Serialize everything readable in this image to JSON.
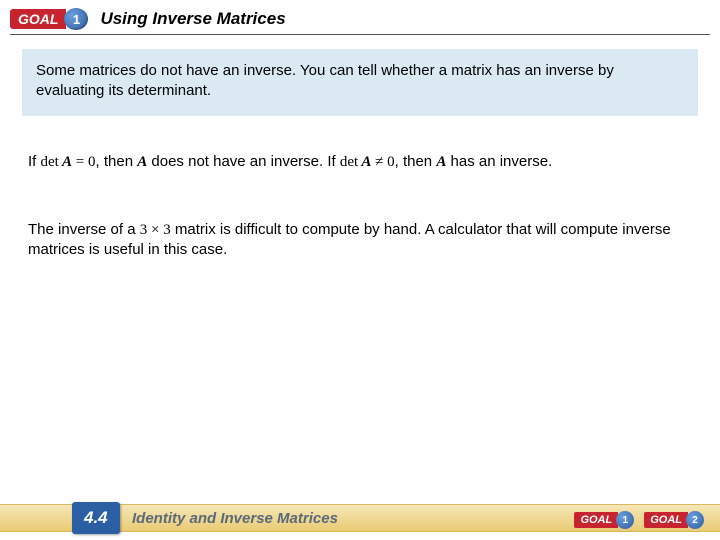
{
  "header": {
    "goal_label": "GOAL",
    "goal_number": "1",
    "title": "Using Inverse Matrices"
  },
  "box": {
    "text": "Some matrices do not have an inverse. You can tell whether a matrix has an inverse by evaluating its determinant."
  },
  "para1": {
    "p1a": "If ",
    "det1": "det",
    "A1": " A",
    "eq_zero": " = 0",
    "p1b": ", then ",
    "A2": "A",
    "p1c": " does not have an inverse. If ",
    "det2": "det",
    "A3": " A",
    "neq": " ≠ 0",
    "p1d": ", then ",
    "A4": "A",
    "p1e": " has an inverse."
  },
  "para2": {
    "p2a": "The inverse of a ",
    "dim": "3 × 3",
    "p2b": " matrix is difficult to compute by hand. A calculator that will compute inverse matrices is useful in this case."
  },
  "footer": {
    "section_number": "4.4",
    "section_title": "Identity and Inverse Matrices",
    "goals": [
      {
        "label": "GOAL",
        "num": "1"
      },
      {
        "label": "GOAL",
        "num": "2"
      }
    ]
  }
}
